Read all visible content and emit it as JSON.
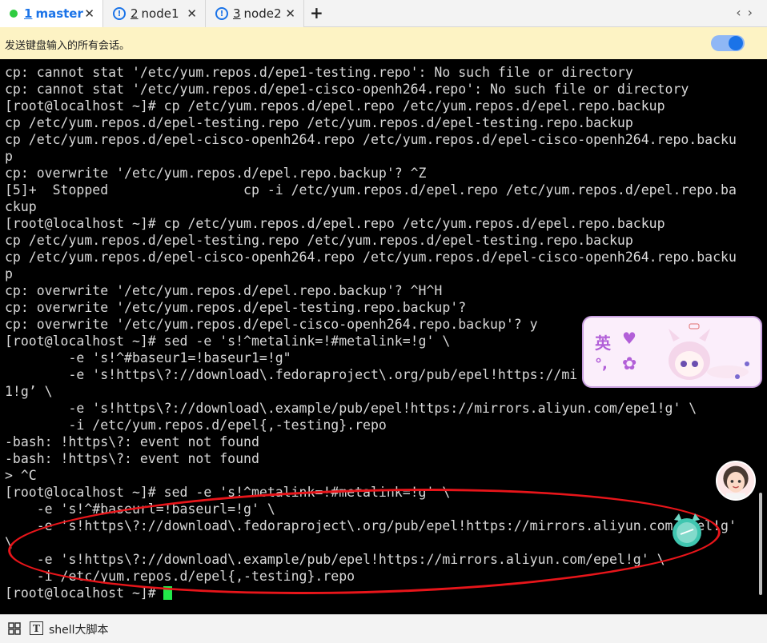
{
  "tabs": [
    {
      "num": "1",
      "name": "master",
      "active": true
    },
    {
      "num": "2",
      "name": "node1",
      "active": false
    },
    {
      "num": "3",
      "name": "node2",
      "active": false
    }
  ],
  "tab_close_glyph": "✕",
  "add_tab_glyph": "+",
  "nav_arrows": "‹›",
  "broadcast": {
    "text": "发送键盘输入的所有会话。",
    "toggle_on": true
  },
  "terminal": {
    "lines": [
      "cp: cannot stat '/etc/yum.repos.d/epe1-testing.repo': No such file or directory",
      "cp: cannot stat '/etc/yum.repos.d/epe1-cisco-openh264.repo': No such file or directory",
      "[root@localhost ~]# cp /etc/yum.repos.d/epel.repo /etc/yum.repos.d/epel.repo.backup",
      "cp /etc/yum.repos.d/epel-testing.repo /etc/yum.repos.d/epel-testing.repo.backup",
      "cp /etc/yum.repos.d/epel-cisco-openh264.repo /etc/yum.repos.d/epel-cisco-openh264.repo.backu",
      "p",
      "cp: overwrite '/etc/yum.repos.d/epel.repo.backup'? ^Z",
      "[5]+  Stopped                 cp -i /etc/yum.repos.d/epel.repo /etc/yum.repos.d/epel.repo.ba",
      "ckup",
      "[root@localhost ~]# cp /etc/yum.repos.d/epel.repo /etc/yum.repos.d/epel.repo.backup",
      "cp /etc/yum.repos.d/epel-testing.repo /etc/yum.repos.d/epel-testing.repo.backup",
      "cp /etc/yum.repos.d/epel-cisco-openh264.repo /etc/yum.repos.d/epel-cisco-openh264.repo.backu",
      "p",
      "cp: overwrite '/etc/yum.repos.d/epel.repo.backup'? ^H^H",
      "cp: overwrite '/etc/yum.repos.d/epel-testing.repo.backup'?",
      "cp: overwrite '/etc/yum.repos.d/epel-cisco-openh264.repo.backup'? y",
      "[root@localhost ~]# sed -e 's!^metalink=!#metalink=!g' \\",
      "        -e 's!^#baseur1=!baseur1=!g\"",
      "        -e 's!https\\?://download\\.fedoraproject\\.org/pub/epel!https://mi",
      "1!g’ \\",
      "        -e 's!https\\?://download\\.example/pub/epel!https://mirrors.aliyun.com/epe1!g' \\",
      "        -i /etc/yum.repos.d/epel{,-testing}.repo",
      "-bash: !https\\?: event not found",
      "-bash: !https\\?: event not found",
      "> ^C",
      "[root@localhost ~]# sed -e 's!^metalink=!#metalink=!g' \\",
      "    -e 's!^#baseurl=!baseurl=!g' \\",
      "    -e 's!https\\?://download\\.fedoraproject\\.org/pub/epel!https://mirrors.aliyun.com/epel!g'",
      "\\",
      "    -e 's!https\\?://download\\.example/pub/epel!https://mirrors.aliyun.com/epel!g' \\",
      "    -i /etc/yum.repos.d/epel{,-testing}.repo",
      "[root@localhost ~]# "
    ]
  },
  "ime": {
    "lang": "英",
    "heart": "♥",
    "punct": "°,",
    "gear": "✿"
  },
  "status": {
    "label": "shell大脚本"
  },
  "colors": {
    "accent": "#1a73e8",
    "cursor": "#22e84a",
    "annotation": "#e8151a",
    "broadcast_bg": "#fdf3c4"
  }
}
